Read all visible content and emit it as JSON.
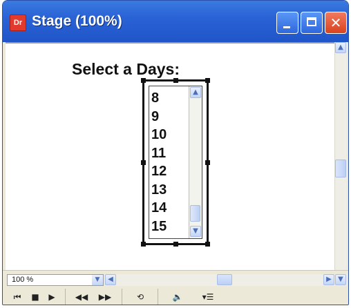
{
  "window": {
    "title": "Stage (100%)",
    "app_icon_label": "Dr",
    "titlebar_color": "#2a63d6",
    "close_color": "#d8431e"
  },
  "stage": {
    "prompt": "Select a Days:",
    "list_items": [
      "8",
      "9",
      "10",
      "11",
      "12",
      "13",
      "14",
      "15"
    ]
  },
  "status": {
    "zoom": "100 %"
  },
  "controls": {
    "rewind_icon": "rewind-icon",
    "stop_icon": "stop-icon",
    "play_icon": "play-icon",
    "step_back_icon": "step-back-icon",
    "step_forward_icon": "step-forward-icon",
    "loop_icon": "loop-icon",
    "volume_icon": "volume-icon",
    "options_icon": "options-icon"
  }
}
